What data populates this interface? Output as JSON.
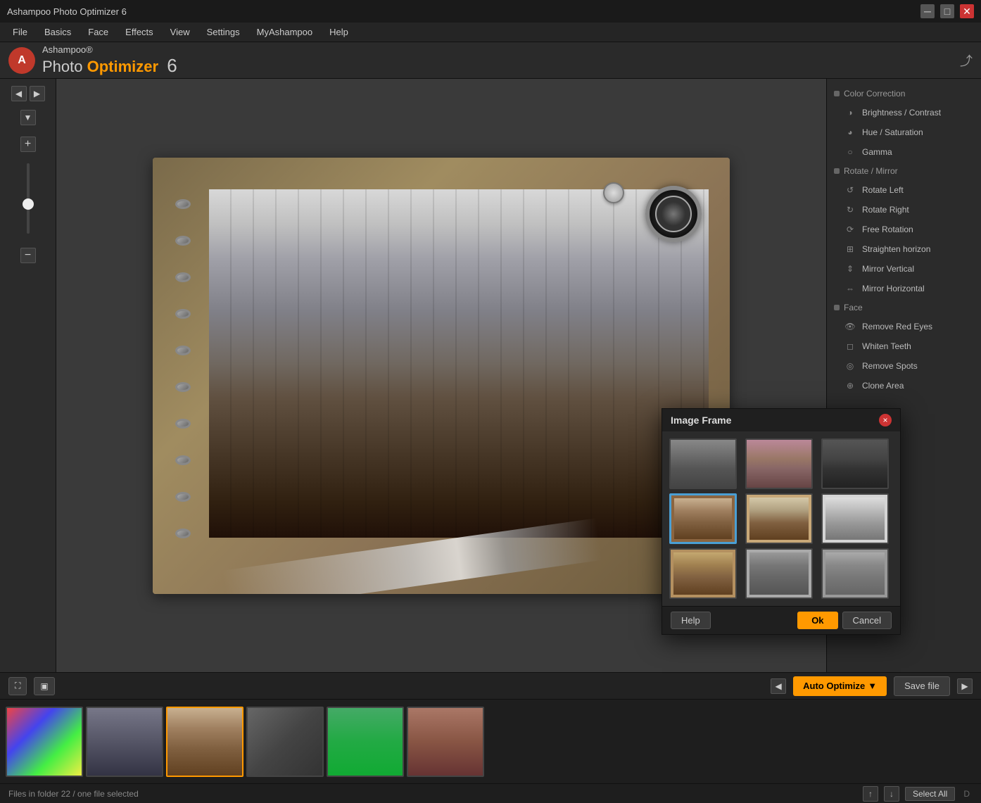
{
  "app": {
    "title": "Ashampoo Photo Optimizer 6",
    "logo": {
      "brand": "Ashampoo®",
      "product": "Photo",
      "optimizer": "Optimizer",
      "version": "6"
    }
  },
  "menubar": {
    "items": [
      "File",
      "Basics",
      "Face",
      "Effects",
      "View",
      "Settings",
      "MyAshampoo",
      "Help"
    ]
  },
  "rightpanel": {
    "sections": [
      {
        "title": "Color Correction",
        "items": [
          "Brightness / Contrast",
          "Hue / Saturation",
          "Gamma"
        ]
      },
      {
        "title": "Rotate / Mirror",
        "items": [
          "Rotate Left",
          "Rotate Right",
          "Free Rotation",
          "Straighten horizon",
          "Mirror Vertical",
          "Mirror Horizontal"
        ]
      },
      {
        "title": "Face",
        "items": [
          "Remove Red Eyes",
          "Whiten Teeth",
          "Remove Spots",
          "Clone Area"
        ]
      }
    ]
  },
  "toolbar": {
    "auto_optimize_label": "Auto Optimize",
    "save_file_label": "Save file"
  },
  "statusbar": {
    "status_text": "Files in folder 22 / one file selected",
    "select_all_label": "Select All"
  },
  "dialog": {
    "title": "Image Frame",
    "close_label": "×",
    "help_label": "Help",
    "ok_label": "Ok",
    "cancel_label": "Cancel",
    "frame_count": 9
  }
}
